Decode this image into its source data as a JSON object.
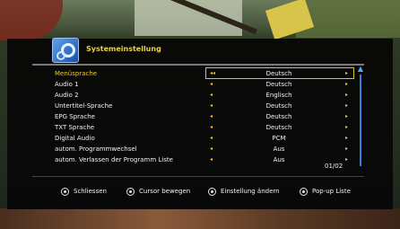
{
  "menu": {
    "title": "Systemeinstellung",
    "rows": [
      {
        "label": "Menüsprache",
        "value": "Deutsch",
        "selected": true
      },
      {
        "label": "Audio 1",
        "value": "Deutsch"
      },
      {
        "label": "Audio 2",
        "value": "Englisch"
      },
      {
        "label": "Untertitel-Sprache",
        "value": "Deutsch"
      },
      {
        "label": "EPG Sprache",
        "value": "Deutsch"
      },
      {
        "label": "TXT Sprache",
        "value": "Deutsch"
      },
      {
        "label": "Digital Audio",
        "value": "PCM"
      },
      {
        "label": "autom. Programmwechsel",
        "value": "Aus"
      },
      {
        "label": "autom. Verlassen der Programm Liste",
        "value": "Aus"
      }
    ],
    "page_indicator": "01/02"
  },
  "footer": {
    "hints": [
      {
        "icon": "exit-button-icon",
        "label": "Schliessen"
      },
      {
        "icon": "cursor-button-icon",
        "label": "Cursor bewegen"
      },
      {
        "icon": "ok-button-icon",
        "label": "Einstellung ändern"
      },
      {
        "icon": "popup-button-icon",
        "label": "Pop-up Liste"
      }
    ]
  },
  "colors": {
    "highlight": "#f0cc1e",
    "text": "#f2f2f2",
    "scrollbar": "#3c7fe0"
  }
}
